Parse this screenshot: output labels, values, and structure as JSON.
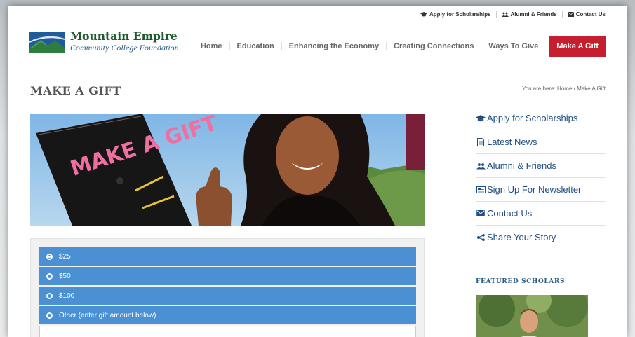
{
  "utility_nav": [
    {
      "icon": "graduation-cap-icon",
      "label": "Apply for Scholarships"
    },
    {
      "icon": "users-icon",
      "label": "Alumni & Friends"
    },
    {
      "icon": "envelope-icon",
      "label": "Contact Us"
    }
  ],
  "logo": {
    "title": "Mountain Empire",
    "subtitle": "Community College Foundation"
  },
  "main_nav": [
    "Home",
    "Education",
    "Enhancing the Economy",
    "Creating Connections",
    "Ways To Give"
  ],
  "cta": "Make A Gift",
  "page_title": "MAKE A GIFT",
  "breadcrumb": {
    "prefix": "You are here:",
    "home": "Home",
    "sep": "/",
    "current": "Make A Gift"
  },
  "gift_options": [
    {
      "label": "$25",
      "selected": true
    },
    {
      "label": "$50",
      "selected": false
    },
    {
      "label": "$100",
      "selected": false
    },
    {
      "label": "Other (enter gift amount below)",
      "selected": false
    }
  ],
  "hero_sign_text": "MAKE A GIFT",
  "sidebar": [
    {
      "icon": "graduation-cap-icon",
      "label": "Apply for Scholarships"
    },
    {
      "icon": "document-icon",
      "label": "Latest News"
    },
    {
      "icon": "users-icon",
      "label": "Alumni & Friends"
    },
    {
      "icon": "newspaper-icon",
      "label": "Sign Up For Newsletter"
    },
    {
      "icon": "envelope-icon",
      "label": "Contact Us"
    },
    {
      "icon": "share-icon",
      "label": "Share Your Story"
    }
  ],
  "featured_heading": "FEATURED SCHOLARS",
  "colors": {
    "cta_red": "#c41e2f",
    "option_blue": "#4a90d2",
    "link_blue": "#1f4f84",
    "logo_green": "#1e5a2c"
  }
}
